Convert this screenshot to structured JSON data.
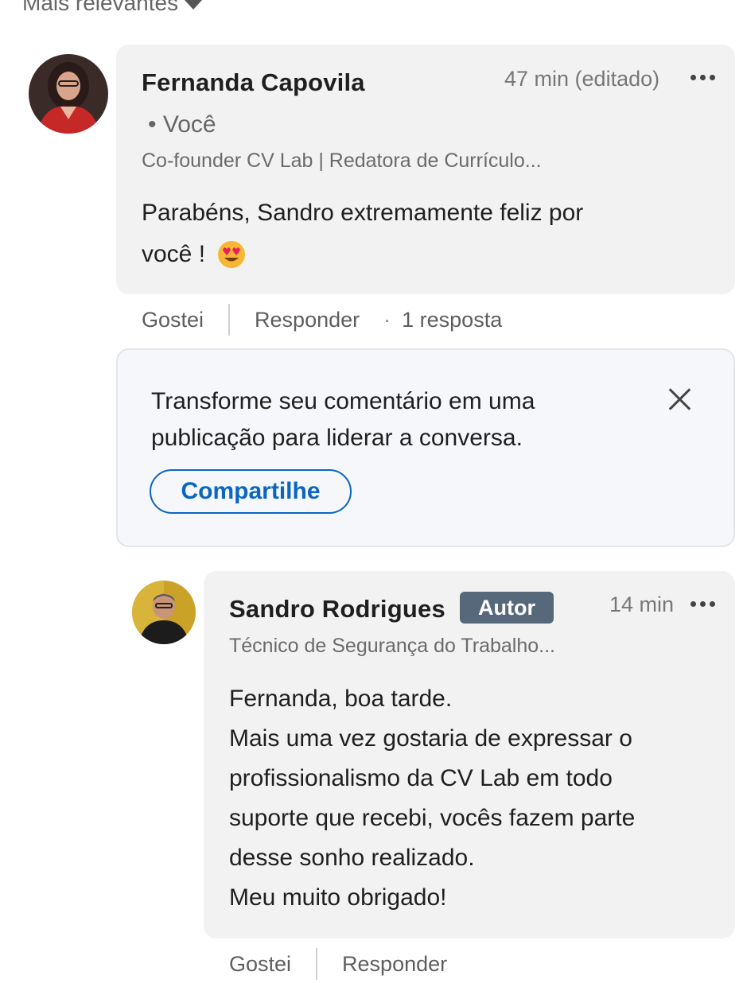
{
  "sort": {
    "label": "Mais relevantes"
  },
  "comment": {
    "author": "Fernanda Capovila",
    "relation": "• Você",
    "headline": "Co-founder CV Lab | Redatora de Currículo...",
    "time": "47 min (editado)",
    "text_line1": "Parabéns, Sandro extremamente feliz por",
    "text_line2": "você !",
    "emoji": "heart-eyes-emoji",
    "actions": {
      "like": "Gostei",
      "reply": "Responder",
      "replies": "1 resposta"
    }
  },
  "promo": {
    "line1": "Transforme seu comentário em uma",
    "line2": "publicação para liderar a conversa.",
    "button": "Compartilhe"
  },
  "reply": {
    "author": "Sandro Rodrigues",
    "badge": "Autor",
    "headline": "Técnico de Segurança do Trabalho...",
    "time": "14 min",
    "lines": [
      "Fernanda, boa tarde.",
      "Mais uma vez gostaria de expressar o",
      "profissionalismo da CV Lab em todo",
      "suporte que recebi, vocês fazem parte",
      "desse sonho realizado.",
      "Meu muito obrigado!"
    ],
    "actions": {
      "like": "Gostei",
      "reply": "Responder"
    }
  },
  "colors": {
    "link": "#0a66c2",
    "bubble": "#f2f2f2",
    "badge": "#56687a"
  }
}
